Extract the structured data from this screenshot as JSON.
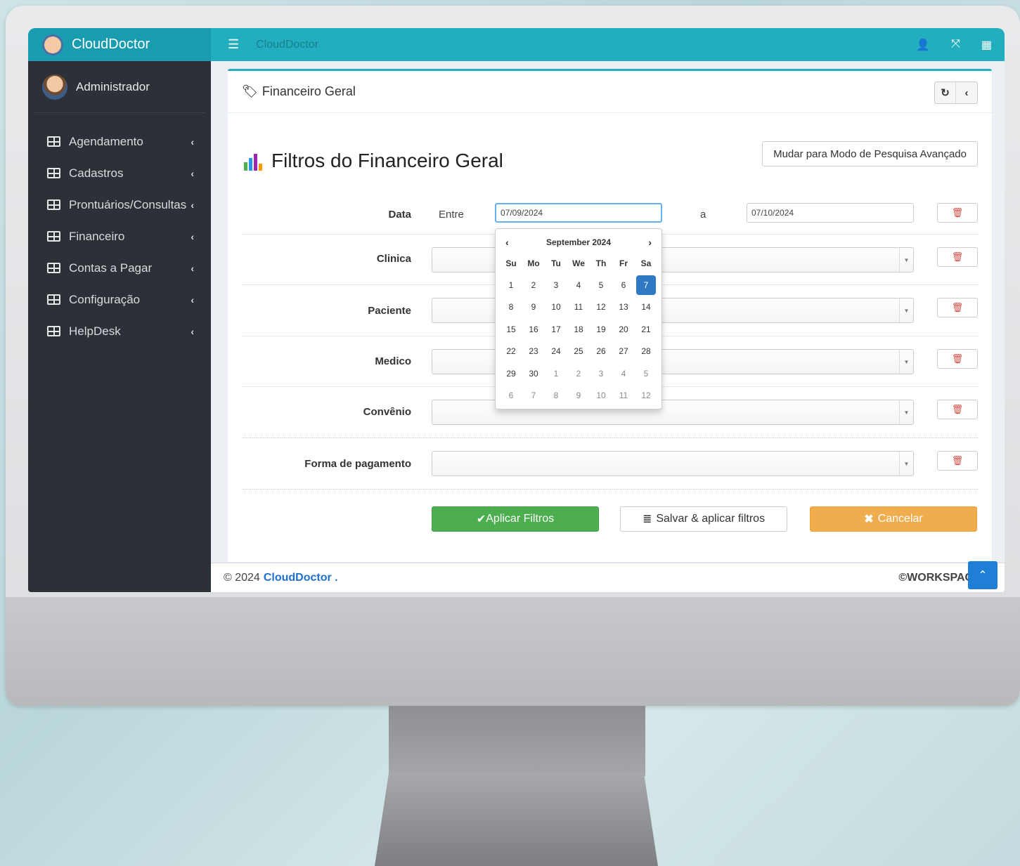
{
  "app": {
    "brand": "CloudDoctor",
    "topbar_title": "CloudDoctor"
  },
  "user": {
    "name": "Administrador"
  },
  "sidebar": {
    "items": [
      {
        "label": "Agendamento"
      },
      {
        "label": "Cadastros"
      },
      {
        "label": "Prontuários/Consultas"
      },
      {
        "label": "Financeiro"
      },
      {
        "label": "Contas a Pagar"
      },
      {
        "label": "Configuração"
      },
      {
        "label": "HelpDesk"
      }
    ]
  },
  "box": {
    "header": "Financeiro Geral"
  },
  "filters": {
    "title": "Filtros do Financeiro Geral",
    "advanced_button": "Mudar para Modo de Pesquisa Avançado",
    "date": {
      "label": "Data",
      "between": "Entre",
      "to": "a",
      "from_value": "07/09/2024",
      "to_value": "07/10/2024"
    },
    "fields": [
      {
        "label": "Clinica"
      },
      {
        "label": "Paciente"
      },
      {
        "label": "Medico"
      },
      {
        "label": "Convênio"
      },
      {
        "label": "Forma de pagamento"
      }
    ]
  },
  "datepicker": {
    "month": "September 2024",
    "weekdays": [
      "Su",
      "Mo",
      "Tu",
      "We",
      "Th",
      "Fr",
      "Sa"
    ],
    "days": [
      [
        "1",
        "2",
        "3",
        "4",
        "5",
        "6",
        "7"
      ],
      [
        "8",
        "9",
        "10",
        "11",
        "12",
        "13",
        "14"
      ],
      [
        "15",
        "16",
        "17",
        "18",
        "19",
        "20",
        "21"
      ],
      [
        "22",
        "23",
        "24",
        "25",
        "26",
        "27",
        "28"
      ],
      [
        "29",
        "30",
        "1",
        "2",
        "3",
        "4",
        "5"
      ],
      [
        "6",
        "7",
        "8",
        "9",
        "10",
        "11",
        "12"
      ]
    ],
    "selected": "7"
  },
  "actions": {
    "apply": "Aplicar Filtros",
    "save_apply": "Salvar & aplicar filtros",
    "cancel": "Cancelar"
  },
  "footer": {
    "copyright": "© 2024",
    "brand": "CloudDoctor .",
    "right": "©WORKSPACE se"
  },
  "colors": {
    "accent": "#22aebf",
    "sidebar": "#2b3136",
    "green": "#4cae4f",
    "orange": "#f0ad4e",
    "selected": "#2f78c4"
  }
}
